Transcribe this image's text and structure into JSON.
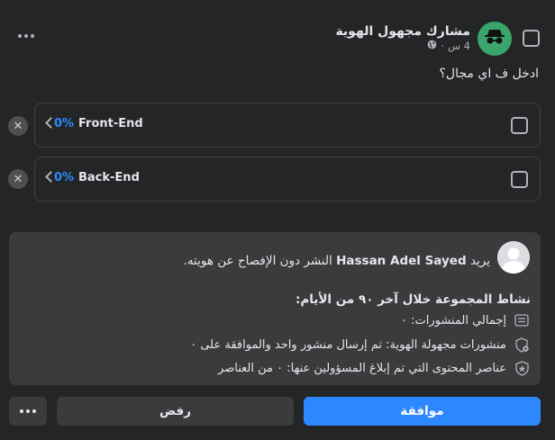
{
  "colors": {
    "background": "#242526",
    "panel": "#3a3b3c",
    "accent": "#2d88ff",
    "avatar_green": "#3aa56b",
    "text": "#e4e6eb",
    "muted": "#b0b3b8"
  },
  "post": {
    "author": "مشارك مجهول الهوية",
    "time": "4 س",
    "audience_icon": "globe-icon",
    "author_icon": "incognito-icon",
    "question": "ادخل ف اي مجال؟"
  },
  "poll": {
    "options": [
      {
        "label": "Front-End",
        "percent": "0%"
      },
      {
        "label": "Back-End",
        "percent": "0%"
      }
    ]
  },
  "request": {
    "prefix": "يريد",
    "user_name": "Hassan Adel Sayed",
    "suffix": "النشر دون الإفصاح عن هويته.",
    "activity_title": "نشاط المجموعة خلال آخر ٩٠ من الأيام:",
    "stats": [
      {
        "icon": "posts-icon",
        "text": "إجمالي المنشورات: ٠"
      },
      {
        "icon": "anonymous-shield-icon",
        "text": "منشورات مجهولة الهوية: تم إرسال منشور واحد والموافقة على ٠"
      },
      {
        "icon": "reported-star-icon",
        "text": "عناصر المحتوى التي تم إبلاغ المسؤولين عنها: ٠ من العناصر"
      }
    ]
  },
  "actions": {
    "approve": "موافقة",
    "reject": "رفض"
  }
}
